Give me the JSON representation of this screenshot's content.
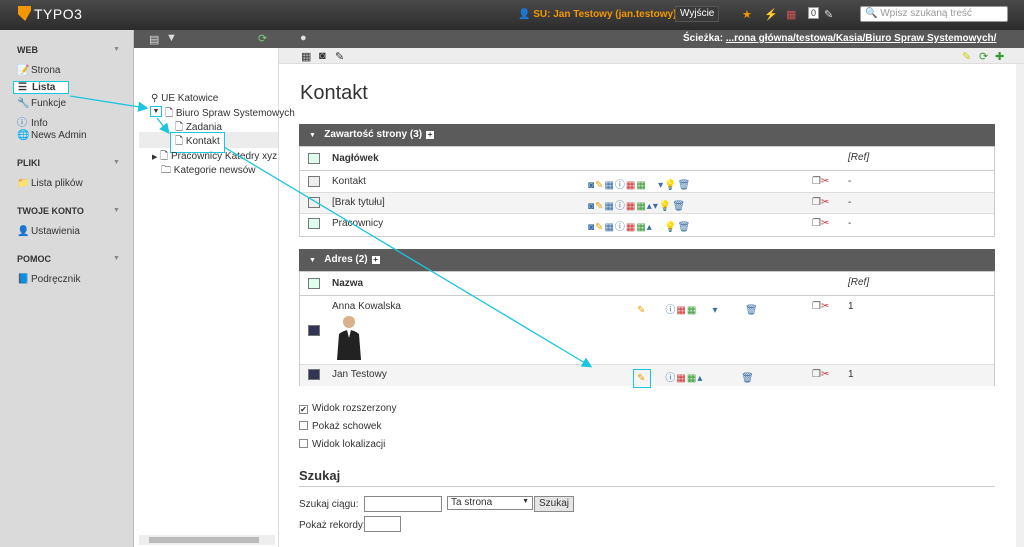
{
  "topbar": {
    "logo": "TYPO3",
    "su_text": "SU: Jan Testowy (jan.testowy)",
    "logout_label": "Wyjście",
    "counter": "0",
    "search_placeholder": "Wpisz szukaną treść"
  },
  "path": {
    "label": "Ścieżka:",
    "value": "...rona główna/testowa/Kasia/Biuro Spraw Systemowych/"
  },
  "modmenu": {
    "sections": [
      {
        "label": "WEB",
        "items": [
          "Strona",
          "Lista",
          "Funkcje",
          "Info",
          "News Admin"
        ]
      },
      {
        "label": "PLIKI",
        "items": [
          "Lista plików"
        ]
      },
      {
        "label": "TWOJE KONTO",
        "items": [
          "Ustawienia"
        ]
      },
      {
        "label": "POMOC",
        "items": [
          "Podręcznik"
        ]
      }
    ],
    "active_item": "Lista"
  },
  "tree": {
    "root": "UE Katowice",
    "nodes": [
      "Biuro Spraw Systemowych",
      "Zadania",
      "Kontakt",
      "Pracownicy Katedry xyz",
      "Kategorie newsów"
    ],
    "selected": "Kontakt"
  },
  "content": {
    "title": "Kontakt",
    "section1": {
      "header": "Zawartość strony (3)",
      "col_label": "Nagłówek",
      "col_ref": "[Ref]",
      "rows": [
        {
          "label": "Kontakt",
          "ref": "-"
        },
        {
          "label": "[Brak tytułu]",
          "ref": "-"
        },
        {
          "label": "Pracownicy",
          "ref": "-"
        }
      ]
    },
    "section2": {
      "header": "Adres (2)",
      "col_label": "Nazwa",
      "col_ref": "[Ref]",
      "rows": [
        {
          "label": "Anna Kowalska",
          "ref": "1"
        },
        {
          "label": "Jan Testowy",
          "ref": "1"
        }
      ]
    },
    "options": [
      {
        "label": "Widok rozszerzony",
        "checked": true
      },
      {
        "label": "Pokaż schowek",
        "checked": false
      },
      {
        "label": "Widok lokalizacji",
        "checked": false
      }
    ],
    "search": {
      "title": "Szukaj",
      "string_label": "Szukaj ciągu:",
      "scope_value": "Ta strona",
      "button_label": "Szukaj",
      "records_label": "Pokaż rekordy:"
    }
  },
  "colors": {
    "accent": "#1ac5e0",
    "brand": "#f49700",
    "header_bg": "#5b5b5b"
  }
}
